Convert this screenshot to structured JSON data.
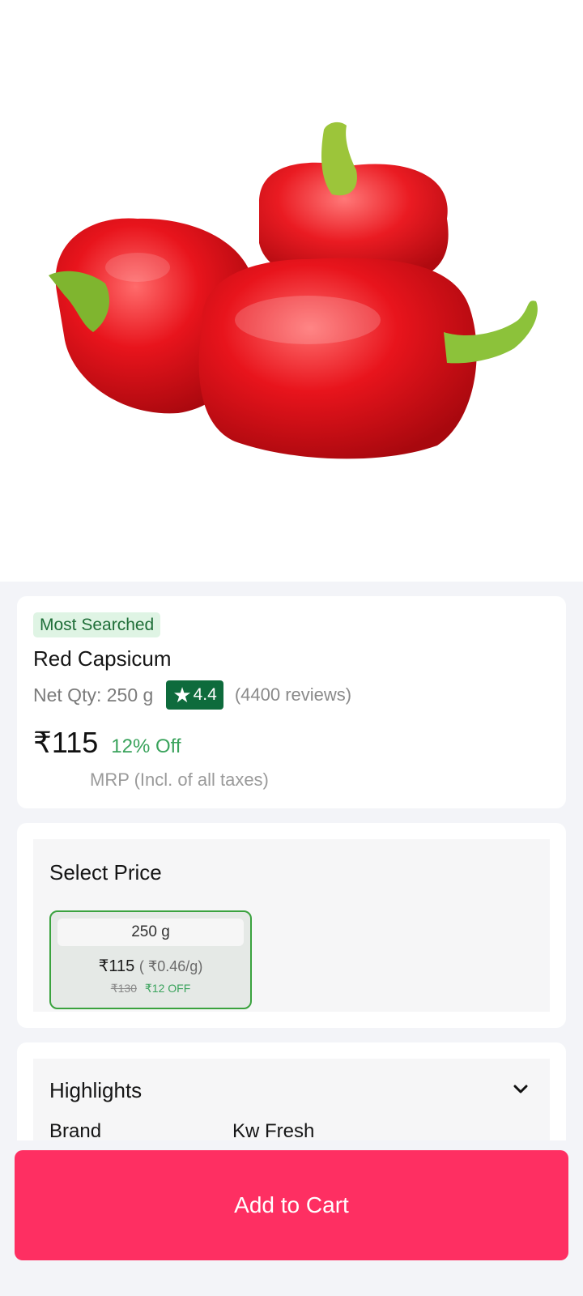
{
  "product": {
    "image_alt": "product-image",
    "badge": "Most Searched",
    "name": "Red Capsicum",
    "net_qty": "Net Qty: 250 g",
    "rating": "4.4",
    "reviews": "(4400 reviews)",
    "price": "₹115",
    "discount": "12% Off",
    "mrp_note": "MRP (Incl. of all taxes)"
  },
  "select_price": {
    "title": "Select Price",
    "options": [
      {
        "weight": "250 g",
        "price": "₹115",
        "unit_price": "( ₹0.46/g)",
        "mrp": "₹130",
        "savings": "₹12 OFF",
        "selected": true
      }
    ]
  },
  "highlights": {
    "title": "Highlights",
    "rows": [
      {
        "label": "Brand",
        "value": "Kw Fresh"
      }
    ]
  },
  "cta": {
    "add_to_cart": "Add to Cart"
  },
  "colors": {
    "accent": "#fe2f62",
    "rating_bg": "#0e6b3c",
    "discount": "#3aa35c",
    "selected_border": "#3aa23e"
  }
}
